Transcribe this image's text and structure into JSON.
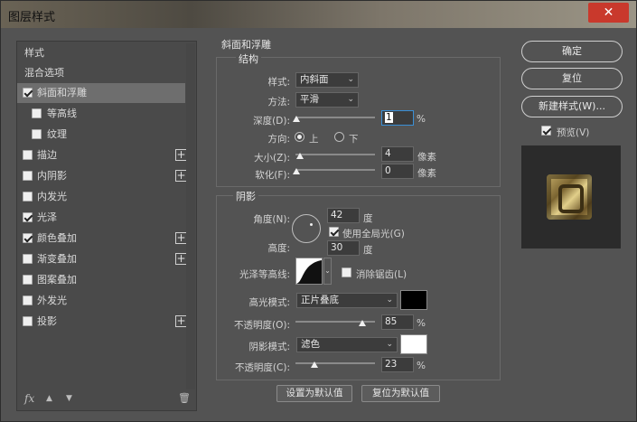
{
  "window": {
    "title": "图层样式",
    "close": "✕"
  },
  "left": {
    "header": "样式",
    "blend_options": "混合选项",
    "items": [
      {
        "label": "斜面和浮雕",
        "checked": true,
        "selected": true
      },
      {
        "label": "等高线",
        "checked": false,
        "sub": true
      },
      {
        "label": "纹理",
        "checked": false,
        "sub": true
      },
      {
        "label": "描边",
        "checked": false,
        "plus": true
      },
      {
        "label": "内阴影",
        "checked": false,
        "plus": true
      },
      {
        "label": "内发光",
        "checked": false
      },
      {
        "label": "光泽",
        "checked": true
      },
      {
        "label": "颜色叠加",
        "checked": true,
        "plus": true
      },
      {
        "label": "渐变叠加",
        "checked": false,
        "plus": true
      },
      {
        "label": "图案叠加",
        "checked": false
      },
      {
        "label": "外发光",
        "checked": false
      },
      {
        "label": "投影",
        "checked": false,
        "plus": true
      }
    ],
    "footer": {
      "fx": "fx",
      "up": "▲",
      "down": "▼",
      "trash": "🗑"
    }
  },
  "bevel": {
    "group_title": "斜面和浮雕",
    "structure_title": "结构",
    "style_label": "样式:",
    "style_value": "内斜面",
    "method_label": "方法:",
    "method_value": "平滑",
    "depth_label": "深度(D):",
    "depth_value": "1",
    "depth_unit": "%",
    "direction_label": "方向:",
    "dir_up": "上",
    "dir_down": "下",
    "size_label": "大小(Z):",
    "size_value": "4",
    "size_unit": "像素",
    "soften_label": "软化(F):",
    "soften_value": "0",
    "soften_unit": "像素"
  },
  "shading": {
    "title": "阴影",
    "angle_label": "角度(N):",
    "angle_value": "42",
    "angle_unit": "度",
    "global_light": "使用全局光(G)",
    "global_light_checked": true,
    "altitude_label": "高度:",
    "altitude_value": "30",
    "altitude_unit": "度",
    "gloss_label": "光泽等高线:",
    "antialias": "消除锯齿(L)",
    "highlight_mode_label": "高光模式:",
    "highlight_mode": "正片叠底",
    "highlight_color": "#000000",
    "highlight_opacity_label": "不透明度(O):",
    "highlight_opacity": "85",
    "highlight_opacity_unit": "%",
    "shadow_mode_label": "阴影模式:",
    "shadow_mode": "滤色",
    "shadow_color": "#ffffff",
    "shadow_opacity_label": "不透明度(C):",
    "shadow_opacity": "23",
    "shadow_opacity_unit": "%"
  },
  "defaults": {
    "make_default": "设置为默认值",
    "reset_default": "复位为默认值"
  },
  "right": {
    "ok": "确定",
    "reset": "复位",
    "new_style": "新建样式(W)...",
    "preview_label": "预览(V)",
    "preview_checked": true
  }
}
